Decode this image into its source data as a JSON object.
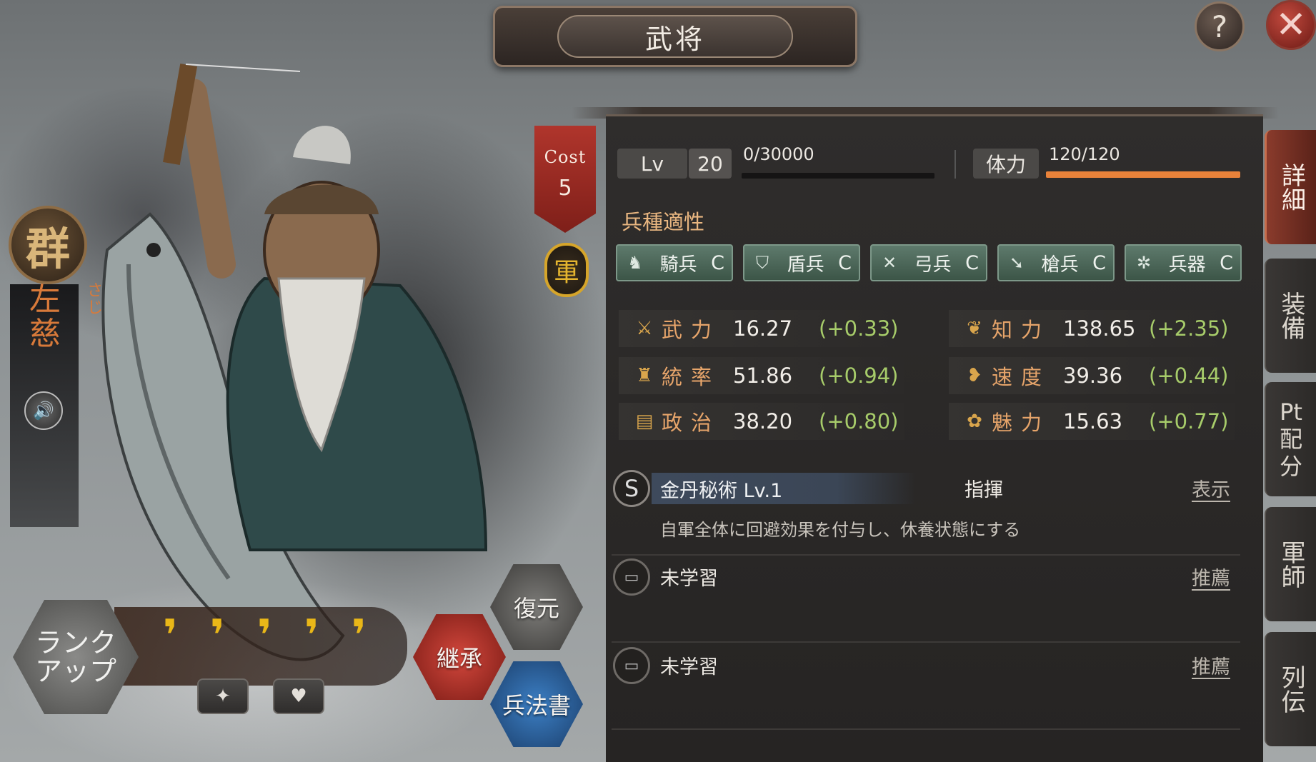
{
  "header": {
    "title": "武将"
  },
  "buttons": {
    "help": "?",
    "close": "✕"
  },
  "general": {
    "faction": "群",
    "name": "左慈",
    "name_reading": "さじ",
    "cost_label": "Cost",
    "cost_value": "5",
    "army_badge": "軍"
  },
  "level": {
    "label": "Lv",
    "value": "20",
    "exp": "0/30000"
  },
  "stamina": {
    "label": "体力",
    "value": "120/120",
    "fill": 1.0
  },
  "troop_section_title": "兵種適性",
  "troops": [
    {
      "icon": "horse-icon",
      "glyph": "♞",
      "name": "騎兵",
      "grade": "C"
    },
    {
      "icon": "shield-icon",
      "glyph": "⛉",
      "name": "盾兵",
      "grade": "C"
    },
    {
      "icon": "bow-icon",
      "glyph": "✕",
      "name": "弓兵",
      "grade": "C"
    },
    {
      "icon": "spear-icon",
      "glyph": "➘",
      "name": "槍兵",
      "grade": "C"
    },
    {
      "icon": "siege-icon",
      "glyph": "✲",
      "name": "兵器",
      "grade": "C"
    }
  ],
  "stats": [
    {
      "icon": "crossed-swords-icon",
      "glyph": "⚔",
      "label": "武力",
      "value": "16.27",
      "delta": "(+0.33)"
    },
    {
      "icon": "intellect-icon",
      "glyph": "❦",
      "label": "知力",
      "value": "138.65",
      "delta": "(+2.35)"
    },
    {
      "icon": "command-icon",
      "glyph": "♜",
      "label": "統率",
      "value": "51.86",
      "delta": "(+0.94)"
    },
    {
      "icon": "speed-icon",
      "glyph": "❥",
      "label": "速度",
      "value": "39.36",
      "delta": "(+0.44)"
    },
    {
      "icon": "politics-icon",
      "glyph": "▤",
      "label": "政治",
      "value": "38.20",
      "delta": "(+0.80)"
    },
    {
      "icon": "charm-icon",
      "glyph": "✿",
      "label": "魅力",
      "value": "15.63",
      "delta": "(+0.77)"
    }
  ],
  "skills": {
    "unique": {
      "badge": "S",
      "name": "金丹秘術 Lv.1",
      "type": "指揮",
      "link": "表示",
      "description": "自軍全体に回避効果を付与し、休養状態にする"
    },
    "slots": [
      {
        "label": "未学習",
        "link": "推薦"
      },
      {
        "label": "未学習",
        "link": "推薦"
      }
    ]
  },
  "side_tabs": [
    {
      "label": "詳細",
      "active": true
    },
    {
      "label": "装備",
      "active": false
    },
    {
      "label": "Pt配分",
      "active": false
    },
    {
      "label": "軍師",
      "active": false
    },
    {
      "label": "列伝",
      "active": false
    }
  ],
  "actions": {
    "rank_up": "ランクアップ",
    "rank_up_line1": "ランク",
    "rank_up_line2": "アップ",
    "restore": "復元",
    "inherit": "継承",
    "tactics_book": "兵法書",
    "rank_drops": 5
  }
}
